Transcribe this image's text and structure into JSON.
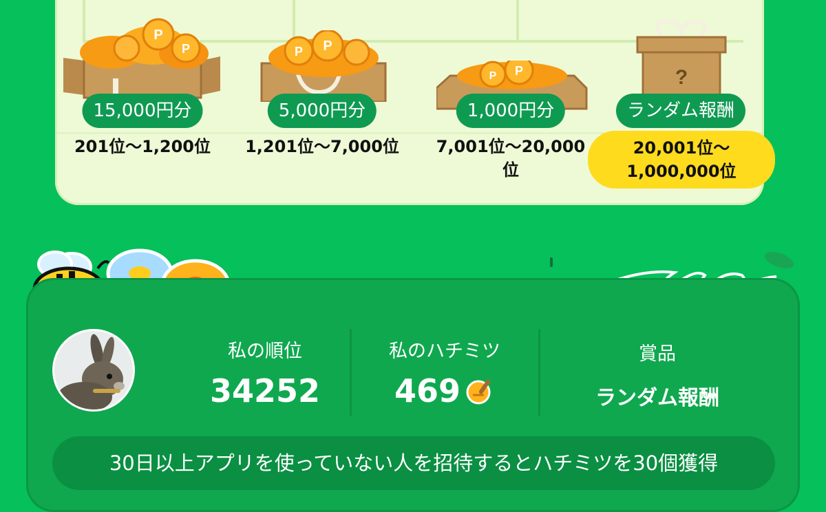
{
  "rewards": {
    "tiers": [
      {
        "prize": "15,000円分",
        "rank": "201位〜1,200位",
        "icon": "large-coin-box-icon"
      },
      {
        "prize": "5,000円分",
        "rank": "1,201位〜7,000位",
        "icon": "coin-bag-icon"
      },
      {
        "prize": "1,000円分",
        "rank": "7,001位〜20,000位",
        "icon": "coin-tray-icon"
      },
      {
        "prize": "ランダム報酬",
        "rank": "20,001位〜1,000,000位",
        "icon": "mystery-gift-box-icon"
      }
    ]
  },
  "my_status": {
    "rank_label": "私の順位",
    "rank_value": "34252",
    "honey_label": "私のハチミツ",
    "honey_value": "469",
    "prize_label": "賞品",
    "prize_value": "ランダム報酬"
  },
  "invite": {
    "text": "30日以上アプリを使っていない人を招待するとハチミツを30個獲得"
  },
  "colors": {
    "background": "#05c05b",
    "card": "#eefad6",
    "pill": "#0f9a52",
    "highlight": "#ffdb1e",
    "status_card": "#0fa84f"
  }
}
